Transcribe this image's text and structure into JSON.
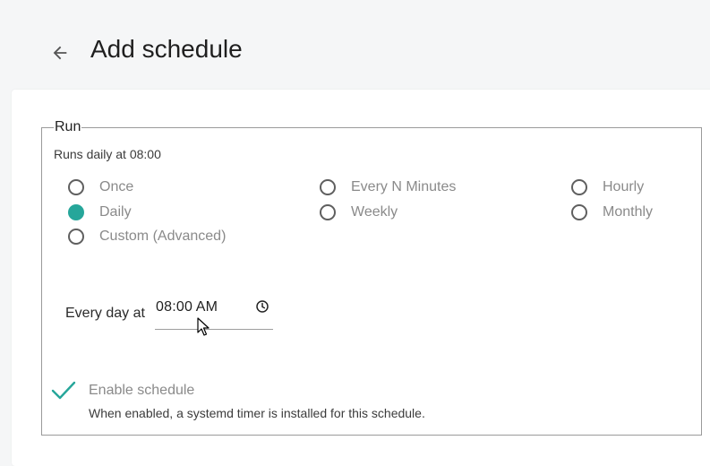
{
  "header": {
    "title": "Add schedule",
    "back_icon": "arrow-left-icon"
  },
  "run": {
    "legend": "Run",
    "summary": "Runs daily at 08:00",
    "options": [
      {
        "label": "Once",
        "checked": false
      },
      {
        "label": "Every N Minutes",
        "checked": false
      },
      {
        "label": "Hourly",
        "checked": false
      },
      {
        "label": "Daily",
        "checked": true
      },
      {
        "label": "Weekly",
        "checked": false
      },
      {
        "label": "Monthly",
        "checked": false
      },
      {
        "label": "Custom (Advanced)",
        "checked": false
      }
    ],
    "time_label": "Every day at",
    "time_value": "08:00 AM",
    "accent_color": "#26a69a"
  },
  "enable": {
    "label": "Enable schedule",
    "checked": true,
    "help": "When enabled, a systemd timer is installed for this schedule."
  }
}
